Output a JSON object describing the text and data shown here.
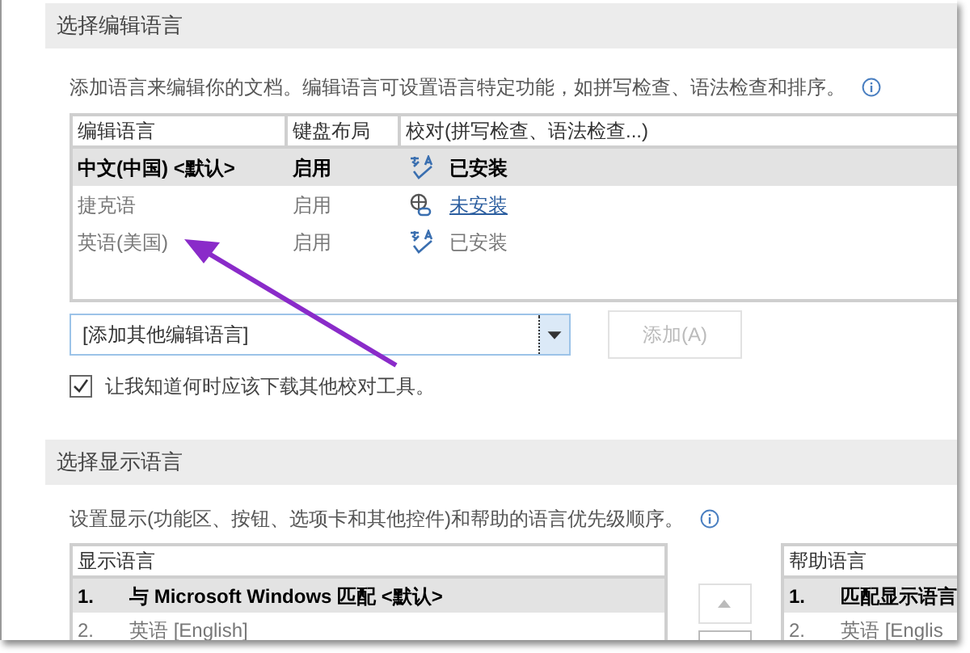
{
  "editing": {
    "title": "选择编辑语言",
    "description": "添加语言来编辑你的文档。编辑语言可设置语言特定功能，如拼写检查、语法检查和排序。",
    "columns": [
      "编辑语言",
      "键盘布局",
      "校对(拼写检查、语法检查...)"
    ],
    "rows": [
      {
        "language": "中文(中国) <默认>",
        "keyboard": "启用",
        "proofing": "已安装",
        "kind": "installed",
        "default": true,
        "selected": true
      },
      {
        "language": "捷克语",
        "keyboard": "启用",
        "proofing": "未安装",
        "kind": "not_installed",
        "default": false,
        "selected": false
      },
      {
        "language": "英语(美国)",
        "keyboard": "启用",
        "proofing": "已安装",
        "kind": "installed",
        "default": false,
        "selected": false
      }
    ],
    "dropdown": {
      "value": "[添加其他编辑语言]"
    },
    "add_button": {
      "label": "添加(A)",
      "disabled": true
    },
    "notify": {
      "label": "让我知道何时应该下载其他校对工具。",
      "checked": true
    }
  },
  "display": {
    "title": "选择显示语言",
    "description": "设置显示(功能区、按钮、选项卡和其他控件)和帮助的语言优先级顺序。",
    "display_list": {
      "header": "显示语言",
      "items": [
        {
          "number": "1.",
          "label": "与 Microsoft Windows 匹配 <默认>",
          "selected": true
        },
        {
          "number": "2.",
          "label": "英语 [English]",
          "selected": false
        }
      ]
    },
    "help_list": {
      "header": "帮助语言",
      "items": [
        {
          "number": "1.",
          "label": "匹配显示语言",
          "selected": true
        },
        {
          "number": "2.",
          "label": "英语 [Englis",
          "selected": false
        }
      ]
    }
  }
}
